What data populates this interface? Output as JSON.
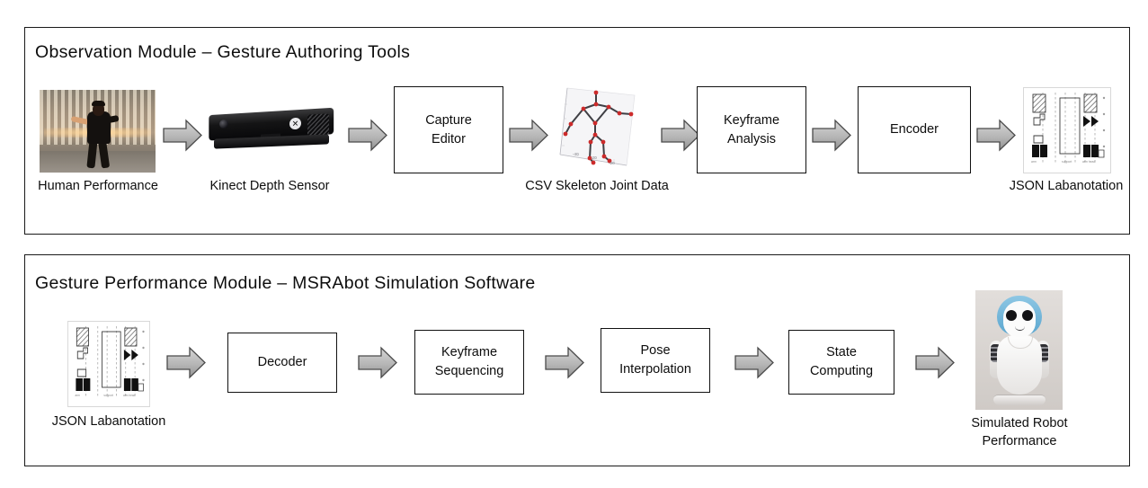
{
  "panels": [
    {
      "id": "observation",
      "title": "Observation  Module – Gesture  Authoring Tools",
      "steps": [
        {
          "kind": "figure",
          "name": "human-performance-photo",
          "caption": "Human  Performance"
        },
        {
          "kind": "arrow",
          "name": "arrow-human-to-kinect"
        },
        {
          "kind": "figure",
          "name": "kinect-depth-sensor-photo",
          "caption": "Kinect Depth Sensor"
        },
        {
          "kind": "arrow",
          "name": "arrow-kinect-to-capture-editor"
        },
        {
          "kind": "box",
          "name": "capture-editor",
          "label": "Capture\nEditor"
        },
        {
          "kind": "arrow",
          "name": "arrow-capture-editor-to-csv"
        },
        {
          "kind": "figure",
          "name": "csv-skeleton-joint-data-plot",
          "caption": "CSV Skeleton  Joint Data"
        },
        {
          "kind": "arrow",
          "name": "arrow-csv-to-keyframe-analysis"
        },
        {
          "kind": "box",
          "name": "keyframe-analysis",
          "label": "Keyframe\nAnalysis"
        },
        {
          "kind": "arrow",
          "name": "arrow-keyframe-analysis-to-encoder"
        },
        {
          "kind": "box",
          "name": "encoder",
          "label": "Encoder"
        },
        {
          "kind": "arrow",
          "name": "arrow-encoder-to-json"
        },
        {
          "kind": "figure",
          "name": "json-labanotation-score",
          "caption": "JSON Labanotation"
        }
      ]
    },
    {
      "id": "performance",
      "title": "Gesture  Performance  Module – MSRAbot Simulation Software",
      "steps": [
        {
          "kind": "figure",
          "name": "json-labanotation-score",
          "caption": "JSON Labanotation"
        },
        {
          "kind": "arrow",
          "name": "arrow-json-to-decoder"
        },
        {
          "kind": "box",
          "name": "decoder",
          "label": "Decoder"
        },
        {
          "kind": "arrow",
          "name": "arrow-decoder-to-keyframe-sequencing"
        },
        {
          "kind": "box",
          "name": "keyframe-sequencing",
          "label": "Keyframe\nSequencing"
        },
        {
          "kind": "arrow",
          "name": "arrow-keyframe-sequencing-to-pose-interpolation"
        },
        {
          "kind": "box",
          "name": "pose-interpolation",
          "label": "Pose\nInterpolation"
        },
        {
          "kind": "arrow",
          "name": "arrow-pose-interpolation-to-state-computing"
        },
        {
          "kind": "box",
          "name": "state-computing",
          "label": "State\nComputing"
        },
        {
          "kind": "arrow",
          "name": "arrow-state-computing-to-robot"
        },
        {
          "kind": "figure",
          "name": "simulated-robot-photo",
          "caption": "Simulated Robot\nPerformance"
        }
      ]
    }
  ],
  "boxes": {
    "capture_editor": "Capture\nEditor",
    "keyframe_analysis": "Keyframe\nAnalysis",
    "encoder": "Encoder",
    "decoder": "Decoder",
    "keyframe_sequencing": "Keyframe\nSequencing",
    "pose_interpolation": "Pose\nInterpolation",
    "state_computing": "State\nComputing"
  },
  "captions": {
    "human_performance": "Human  Performance",
    "kinect_depth_sensor": "Kinect Depth Sensor",
    "csv_skeleton_joint_data": "CSV Skeleton  Joint Data",
    "json_labanotation_top": "JSON Labanotation",
    "json_labanotation_bottom": "JSON Labanotation",
    "simulated_robot_performance": "Simulated Robot\nPerformance"
  },
  "skeleton_plot": {
    "axis_tick_labels": [
      "-40",
      "-20",
      "-20"
    ],
    "joint_color": "#cc2b2b",
    "bone_color": "#3f3f44",
    "panel_color": "#f4f4f6"
  },
  "colors": {
    "panel_border": "#1a1a1a",
    "box_border": "#111111",
    "arrow_fill_light": "#cfcfcf",
    "arrow_fill_dark": "#9a9a9a",
    "arrow_border": "#4a4a4a",
    "text": "#0d0d0d",
    "robot_hair": "#5ba6cf"
  }
}
